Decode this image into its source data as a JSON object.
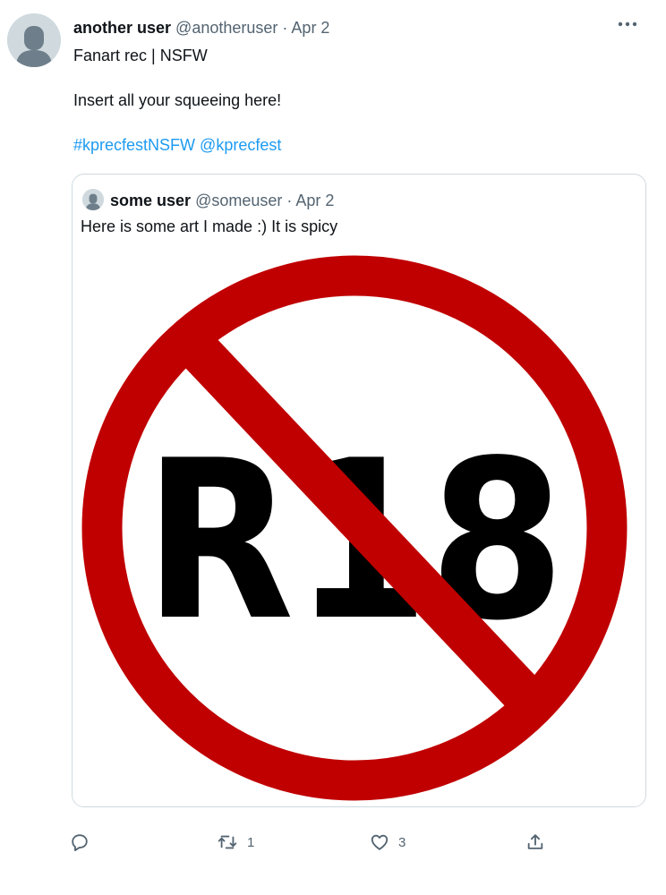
{
  "tweet": {
    "author_name": "another user",
    "author_handle": "@anotheruser",
    "date": "Apr 2",
    "separator": "·",
    "text_line1": "Fanart rec | NSFW",
    "text_line2": "Insert all your squeeing here!",
    "hashtag": "#kprecfestNSFW",
    "mention": "@kprecfest",
    "more_icon": "ellipsis-icon"
  },
  "quoted": {
    "author_name": "some user",
    "author_handle": "@someuser",
    "date": "Apr 2",
    "separator": "·",
    "text": "Here is some art I made :) It is spicy",
    "image": {
      "label": "R18",
      "description": "no-R18 prohibition sign"
    }
  },
  "actions": {
    "reply_count": "",
    "retweet_count": "1",
    "like_count": "3",
    "icons": [
      "reply-icon",
      "retweet-icon",
      "like-icon",
      "share-icon"
    ]
  },
  "colors": {
    "link": "#1d9bf0",
    "muted": "#536471",
    "prohibition_red": "#c00000",
    "border": "#cfd9de"
  }
}
